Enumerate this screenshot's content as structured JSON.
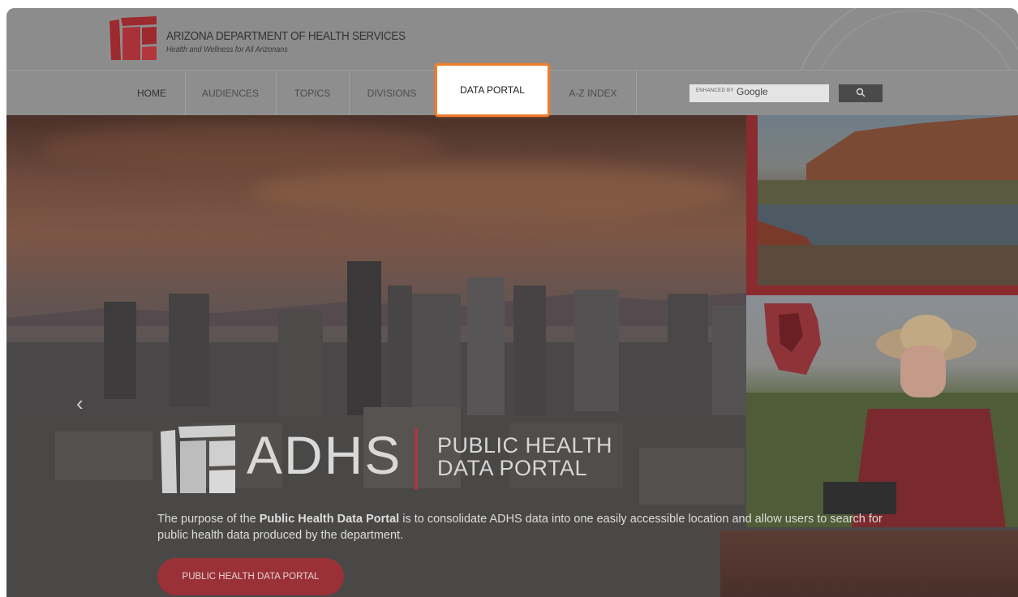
{
  "header": {
    "org_name": "ARIZONA DEPARTMENT OF HEALTH SERVICES",
    "tagline": "Health and Wellness for All Arizonans"
  },
  "nav": {
    "items": [
      "HOME",
      "AUDIENCES",
      "TOPICS",
      "DIVISIONS",
      "DATA PORTAL",
      "A-Z INDEX"
    ],
    "highlighted": "DATA PORTAL"
  },
  "search": {
    "label": "ENHANCED BY",
    "brand": "Google",
    "button_icon": "search-icon"
  },
  "hero": {
    "brand_text": "ADHS",
    "portal_title_line1": "PUBLIC HEALTH",
    "portal_title_line2": "DATA PORTAL",
    "purpose_pre": "The purpose of the ",
    "purpose_bold": "Public Health Data Portal",
    "purpose_post": " is to consolidate ADHS data into one easily accessible location and allow users to search for public health data produced by the department.",
    "cta_label": "PUBLIC HEALTH DATA PORTAL",
    "prev_icon": "chevron-left-icon"
  },
  "colors": {
    "accent_red": "#9a3038",
    "highlight_border": "#f07d2c"
  }
}
